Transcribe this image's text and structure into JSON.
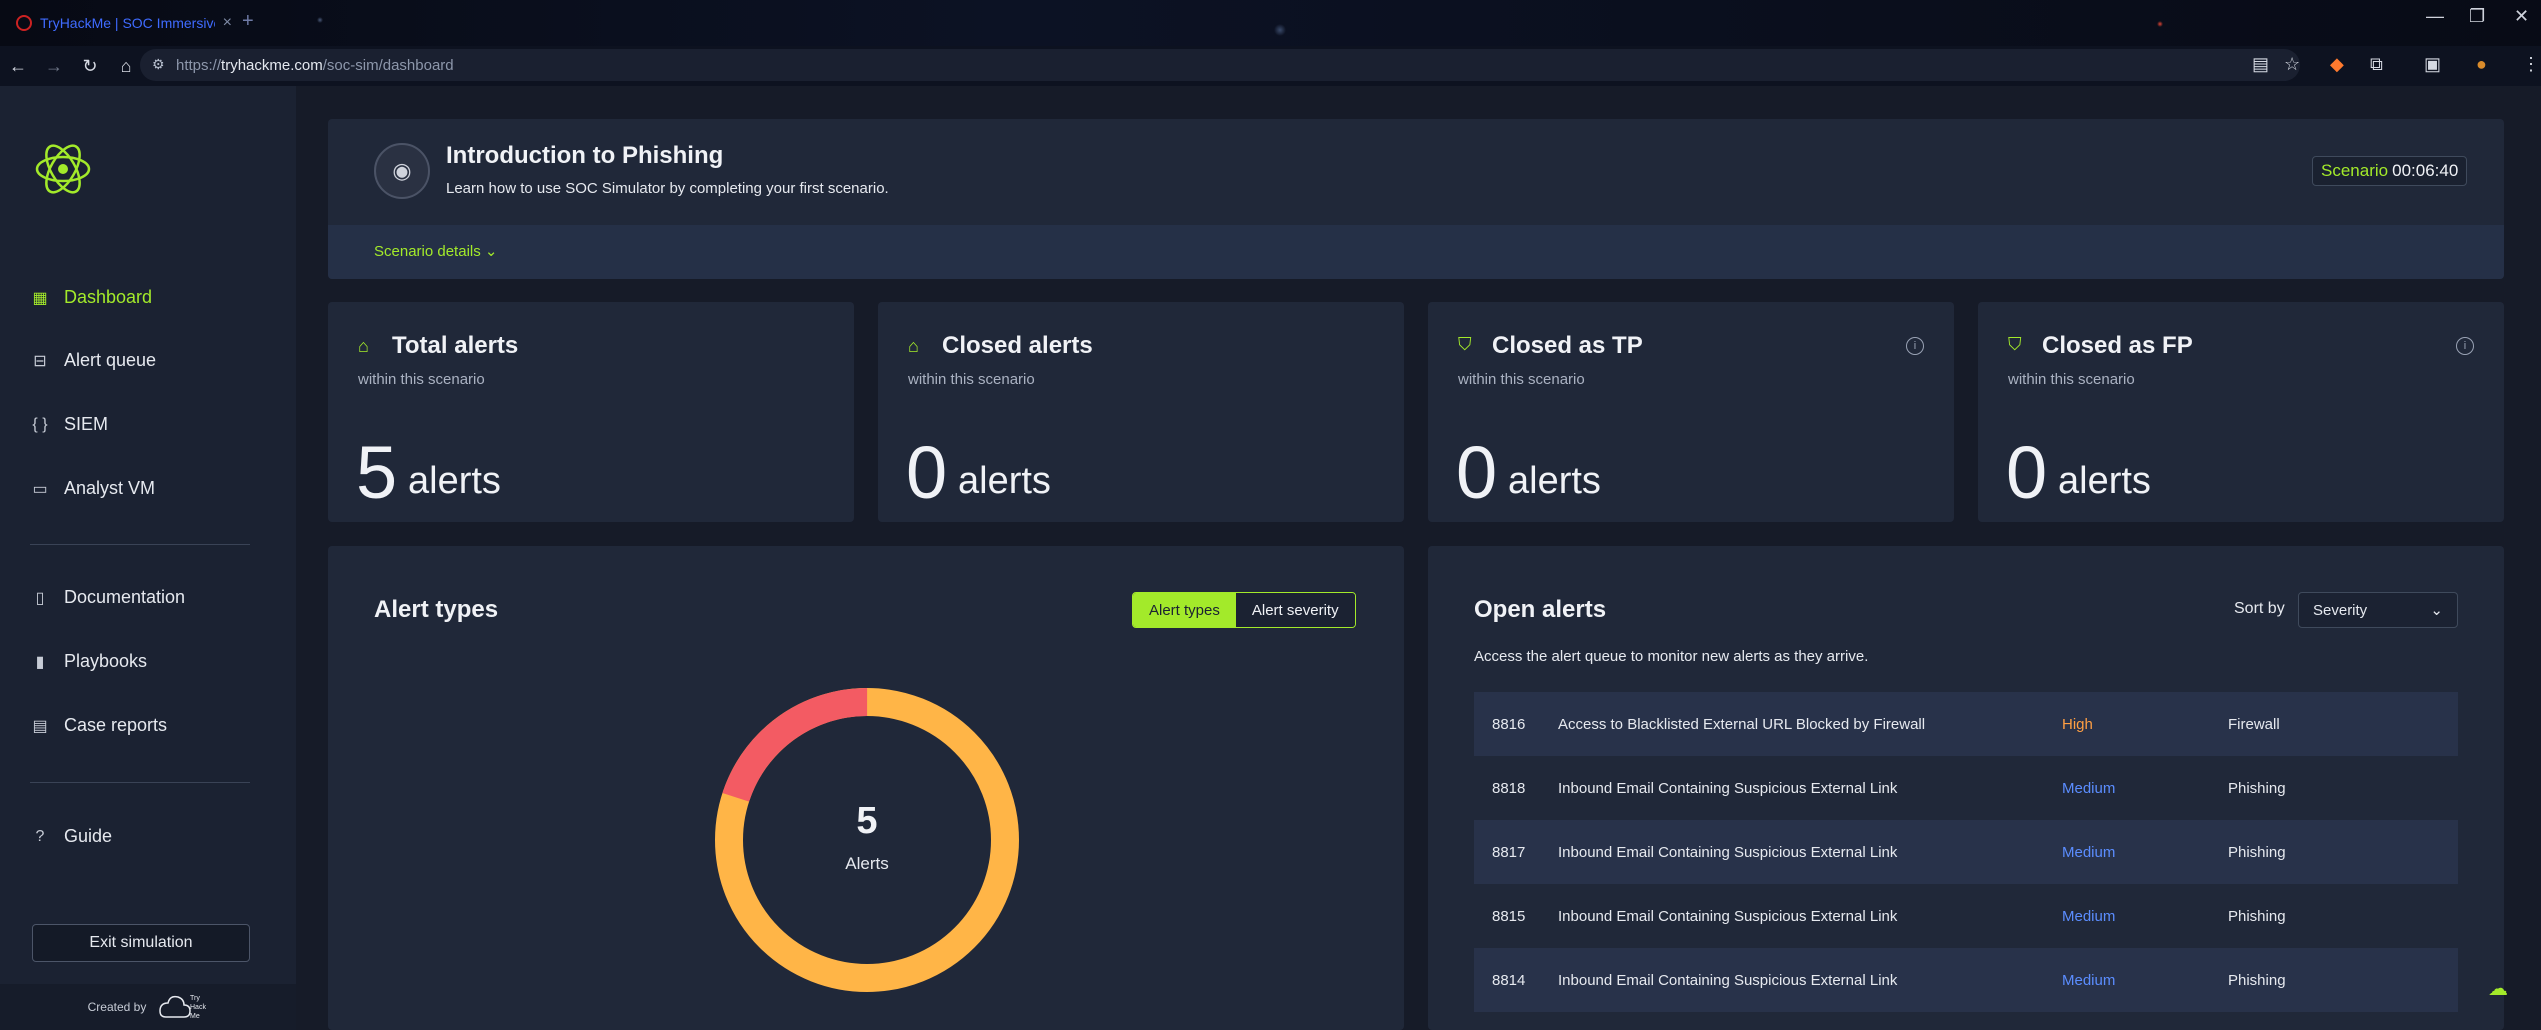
{
  "browser": {
    "tab_title": "TryHackMe | SOC Immersive S",
    "tab_close": "×",
    "new_tab": "+",
    "url_scheme": "https://",
    "url_host": "tryhackme.com",
    "url_path": "/soc-sim/dashboard"
  },
  "sidebar": {
    "items": [
      {
        "label": "Dashboard",
        "icon": "dashboard-icon",
        "active": true
      },
      {
        "label": "Alert queue",
        "icon": "alert-queue-icon"
      },
      {
        "label": "SIEM",
        "icon": "siem-icon"
      },
      {
        "label": "Analyst VM",
        "icon": "monitor-icon"
      }
    ],
    "items2": [
      {
        "label": "Documentation",
        "icon": "document-icon"
      },
      {
        "label": "Playbooks",
        "icon": "book-icon"
      },
      {
        "label": "Case reports",
        "icon": "report-icon"
      }
    ],
    "guide": "Guide",
    "exit": "Exit simulation",
    "created_by": "Created by",
    "thm_logo_lines": [
      "Try",
      "Hack",
      "Me"
    ]
  },
  "scenario": {
    "title": "Introduction to Phishing",
    "subtitle": "Learn how to use SOC Simulator by completing your first scenario.",
    "timer_label": "Scenario",
    "timer_value": "00:06:40",
    "details": "Scenario details"
  },
  "stats": [
    {
      "title": "Total alerts",
      "sub": "within this scenario",
      "value": "5",
      "unit": "alerts"
    },
    {
      "title": "Closed alerts",
      "sub": "within this scenario",
      "value": "0",
      "unit": "alerts"
    },
    {
      "title": "Closed as TP",
      "sub": "within this scenario",
      "value": "0",
      "unit": "alerts"
    },
    {
      "title": "Closed as FP",
      "sub": "within this scenario",
      "value": "0",
      "unit": "alerts"
    }
  ],
  "alert_types": {
    "title": "Alert types",
    "toggle_on": "Alert types",
    "toggle_off": "Alert severity",
    "center_value": "5",
    "center_label": "Alerts",
    "colors": {
      "major": "#ffb547",
      "minor": "#f35b63"
    },
    "minor_fraction": 0.2
  },
  "open_alerts": {
    "title": "Open alerts",
    "sort_label": "Sort by",
    "sort_value": "Severity",
    "subtitle": "Access the alert queue to monitor new alerts as they arrive.",
    "rows": [
      {
        "id": "8816",
        "name": "Access to Blacklisted External URL Blocked by Firewall",
        "severity": "High",
        "type": "Firewall"
      },
      {
        "id": "8818",
        "name": "Inbound Email Containing Suspicious External Link",
        "severity": "Medium",
        "type": "Phishing"
      },
      {
        "id": "8817",
        "name": "Inbound Email Containing Suspicious External Link",
        "severity": "Medium",
        "type": "Phishing"
      },
      {
        "id": "8815",
        "name": "Inbound Email Containing Suspicious External Link",
        "severity": "Medium",
        "type": "Phishing"
      },
      {
        "id": "8814",
        "name": "Inbound Email Containing Suspicious External Link",
        "severity": "Medium",
        "type": "Phishing"
      }
    ]
  },
  "colors": {
    "accent": "#a3ea2a",
    "high": "#ff9f43",
    "medium": "#5b8dff"
  }
}
